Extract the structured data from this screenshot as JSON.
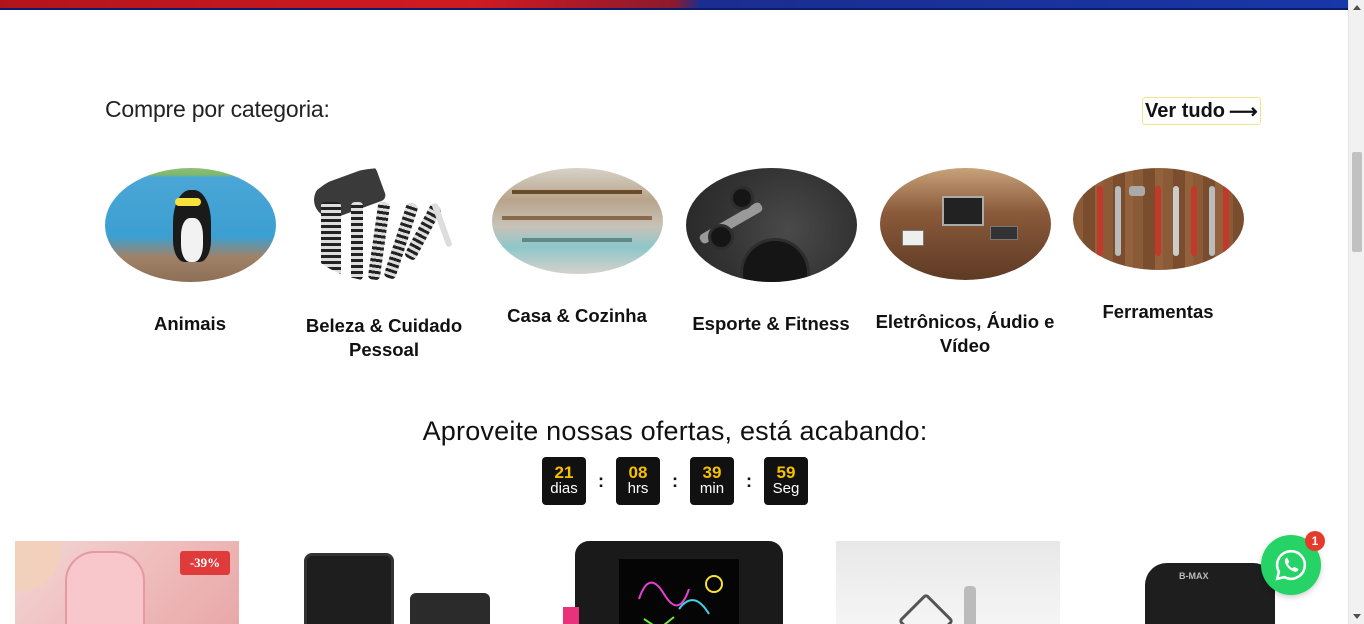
{
  "category_section": {
    "title": "Compre por categoria:",
    "see_all_label": "Ver tudo",
    "see_all_icon": "arrow-right-icon",
    "items": [
      {
        "label": "Animais"
      },
      {
        "label": "Beleza & Cuidado Pessoal"
      },
      {
        "label": "Casa & Cozinha"
      },
      {
        "label": "Esporte & Fitness"
      },
      {
        "label": "Eletrônicos, Áudio e Vídeo"
      },
      {
        "label": "Ferramentas"
      }
    ]
  },
  "offers": {
    "title": "Aproveite nossas ofertas, está acabando:",
    "countdown": [
      {
        "value": "21",
        "unit": "dias"
      },
      {
        "value": "08",
        "unit": "hrs"
      },
      {
        "value": "39",
        "unit": "min"
      },
      {
        "value": "59",
        "unit": "Seg"
      }
    ],
    "separator": ":"
  },
  "products": [
    {
      "discount_badge": "-39%"
    },
    {
      "brand_text": ""
    },
    {},
    {},
    {
      "brand_text": "B-MAX"
    }
  ],
  "whatsapp": {
    "icon": "whatsapp-icon",
    "notification_count": "1"
  },
  "colors": {
    "countdown_number": "#f5c000",
    "countdown_box": "#111111",
    "badge_red": "#e03b3b",
    "whatsapp_green": "#25d366"
  }
}
